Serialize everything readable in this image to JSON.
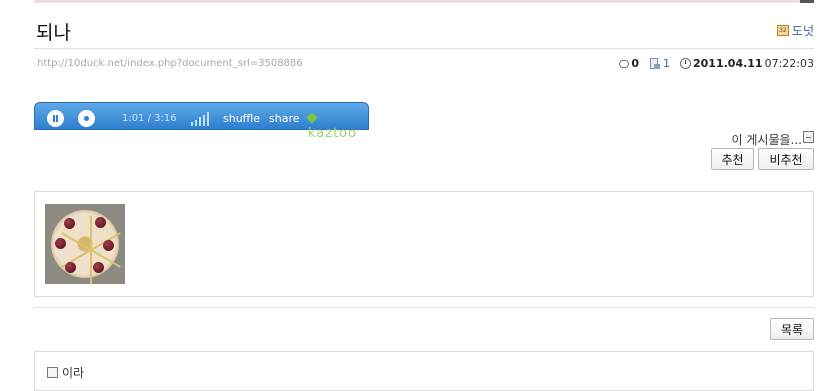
{
  "post": {
    "title": "되나",
    "category": "도넛",
    "category_icon": "category-folder-icon",
    "url": "http://10duck.net/index.php?document_srl=3508886",
    "comment_count": "0",
    "view_count": "1",
    "date": "2011.04.11",
    "time": "07:22:03"
  },
  "player": {
    "time_display": "1:01 / 3:16",
    "shuffle_label": "shuffle",
    "share_label": "share",
    "brand": "kaztoo",
    "colors": {
      "bar": "#2f7fcf",
      "brand": "#9fd36a"
    }
  },
  "actions": {
    "share_text": "이 게시물을...",
    "recommend_label": "추천",
    "not_recommend_label": "비추천",
    "list_label": "목록"
  },
  "tags": {
    "label": "이라"
  },
  "colors": {
    "link": "#3c63a6",
    "url_text": "#a8a8a8",
    "border": "#dcdcdc"
  }
}
